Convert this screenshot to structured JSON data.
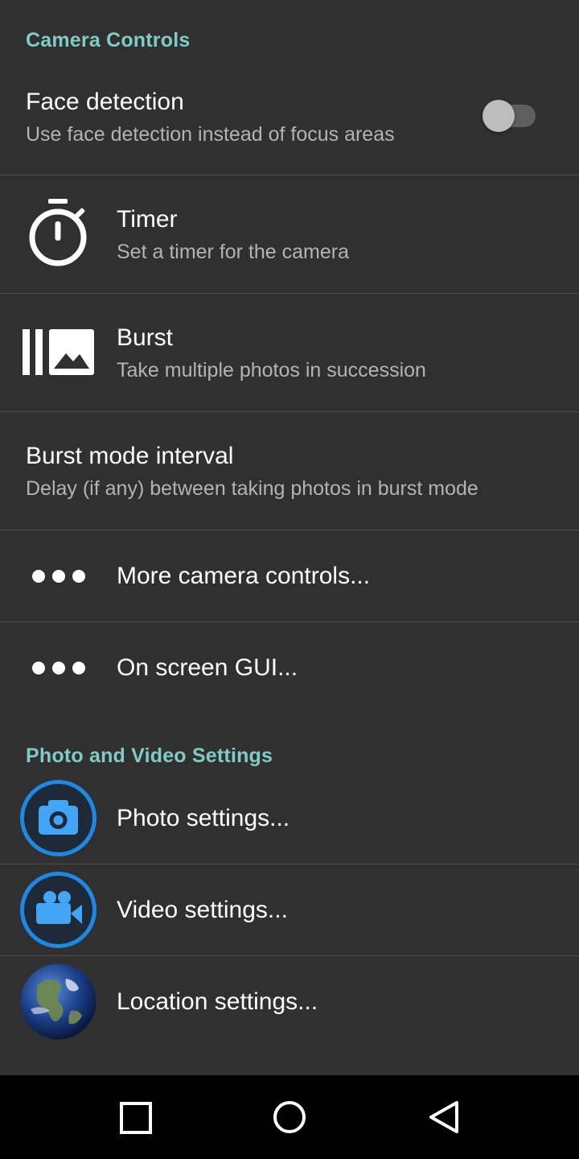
{
  "sections": {
    "camera_controls": "Camera Controls",
    "photo_video": "Photo and Video Settings"
  },
  "face_detection": {
    "title": "Face detection",
    "summary": "Use face detection instead of focus areas",
    "enabled": false
  },
  "timer": {
    "title": "Timer",
    "summary": "Set a timer for the camera",
    "icon": "timer-icon"
  },
  "burst": {
    "title": "Burst",
    "summary": "Take multiple photos in succession",
    "icon": "burst-icon"
  },
  "burst_interval": {
    "title": "Burst mode interval",
    "summary": "Delay (if any) between taking photos in burst mode"
  },
  "more_controls": {
    "title": "More camera controls...",
    "icon": "more-icon"
  },
  "on_screen_gui": {
    "title": "On screen GUI...",
    "icon": "more-icon"
  },
  "photo_settings": {
    "title": "Photo settings...",
    "icon": "camera-icon"
  },
  "video_settings": {
    "title": "Video settings...",
    "icon": "video-camera-icon"
  },
  "location_settings": {
    "title": "Location settings...",
    "icon": "globe-icon"
  },
  "colors": {
    "accent": "#80cbc4",
    "background": "#303030",
    "icon_blue": "#1e88e5"
  },
  "navbar": {
    "recents": "recents-icon",
    "home": "home-icon",
    "back": "back-icon"
  }
}
